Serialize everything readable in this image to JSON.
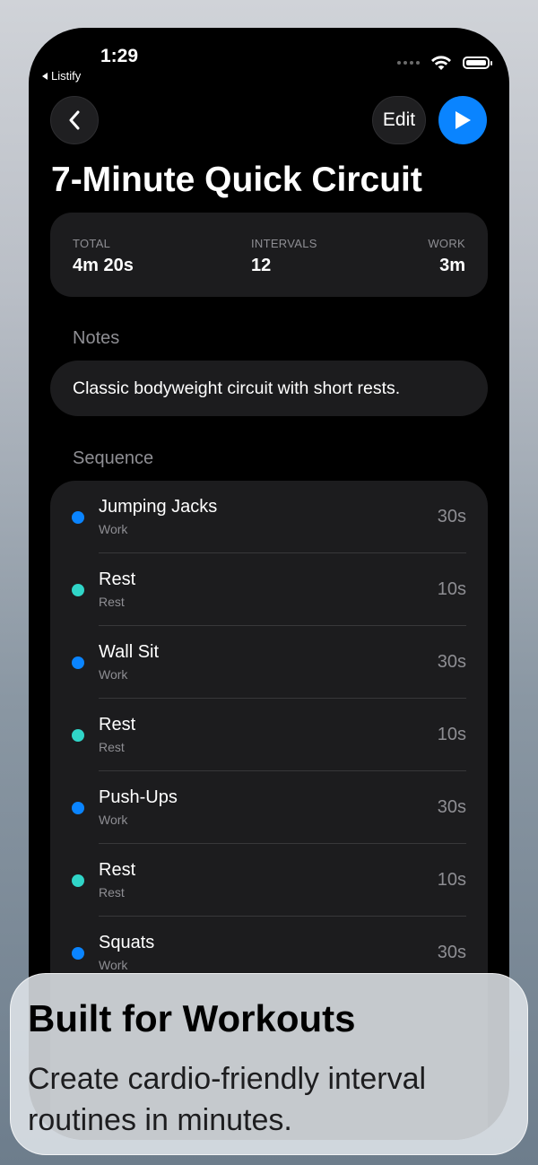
{
  "status_bar": {
    "time": "1:29",
    "back_app": "Listify"
  },
  "nav": {
    "edit_label": "Edit"
  },
  "title": "7-Minute Quick Circuit",
  "stats": {
    "total_label": "TOTAL",
    "total_value": "4m 20s",
    "intervals_label": "INTERVALS",
    "intervals_value": "12",
    "work_label": "WORK",
    "work_value": "3m"
  },
  "notes": {
    "label": "Notes",
    "text": "Classic bodyweight circuit with short rests."
  },
  "sequence": {
    "label": "Sequence",
    "items": [
      {
        "name": "Jumping Jacks",
        "type": "Work",
        "duration": "30s"
      },
      {
        "name": "Rest",
        "type": "Rest",
        "duration": "10s"
      },
      {
        "name": "Wall Sit",
        "type": "Work",
        "duration": "30s"
      },
      {
        "name": "Rest",
        "type": "Rest",
        "duration": "10s"
      },
      {
        "name": "Push-Ups",
        "type": "Work",
        "duration": "30s"
      },
      {
        "name": "Rest",
        "type": "Rest",
        "duration": "10s"
      },
      {
        "name": "Squats",
        "type": "Work",
        "duration": "30s"
      }
    ]
  },
  "colors": {
    "work": "#0a84ff",
    "rest": "#30d5c8",
    "accent": "#0a84ff"
  },
  "promo": {
    "title": "Built for Workouts",
    "subtitle": "Create cardio-friendly interval routines in minutes."
  }
}
